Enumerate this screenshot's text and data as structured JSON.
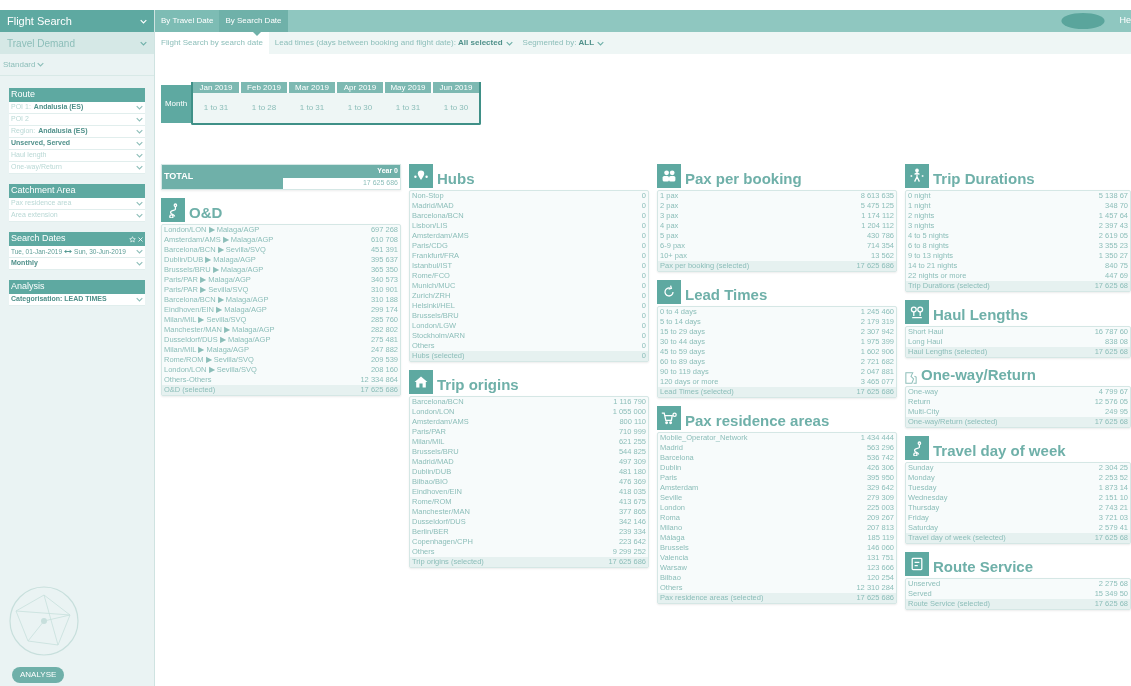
{
  "sidebar": {
    "title": "Flight Search",
    "module": "Travel Demand",
    "view": "Standard",
    "sections": [
      {
        "title": "Route",
        "kind": "plain",
        "fields": [
          {
            "kind": "select",
            "label": "POI 1:",
            "value": "Andalusia (ES)"
          },
          {
            "kind": "select",
            "label": "POI 2"
          },
          {
            "kind": "select",
            "label": "Region:",
            "value": "Andalusia (ES)"
          },
          {
            "kind": "select",
            "value": "Unserved, Served"
          },
          {
            "kind": "select",
            "label": "Haul length"
          },
          {
            "kind": "select",
            "label": "One-way/Return"
          }
        ]
      },
      {
        "title": "Catchment Area",
        "kind": "plain",
        "fields": [
          {
            "kind": "select",
            "label": "Pax residence area"
          },
          {
            "kind": "select",
            "label": "Area extension"
          }
        ]
      },
      {
        "title": "Search Dates",
        "kind": "dates",
        "fields": [
          {
            "kind": "range",
            "from": "Tue, 01-Jan-2019",
            "to": "Sun, 30-Jun-2019"
          },
          {
            "kind": "select",
            "value": "Monthly"
          }
        ]
      },
      {
        "title": "Analysis",
        "kind": "plain",
        "fields": [
          {
            "kind": "select",
            "value": "Categorisation: LEAD TIMES"
          }
        ]
      }
    ],
    "button": "ANALYSE"
  },
  "tabs": [
    {
      "label": "By Travel Date",
      "selected": false
    },
    {
      "label": "By Search Date",
      "selected": true
    }
  ],
  "user": "He",
  "subheader": {
    "title": "Flight Search by search date",
    "filters": [
      "Lead times (days between booking and flight date): **All selected**",
      "Segmented by: **ALL**"
    ]
  },
  "timeline": {
    "row_label": "Month",
    "months": [
      {
        "label": "Jan 2019",
        "range": "1 to 31"
      },
      {
        "label": "Feb 2019",
        "range": "1 to 28"
      },
      {
        "label": "Mar 2019",
        "range": "1 to 31"
      },
      {
        "label": "Apr 2019",
        "range": "1 to 30"
      },
      {
        "label": "May 2019",
        "range": "1 to 31"
      },
      {
        "label": "Jun 2019",
        "range": "1 to 30"
      }
    ]
  },
  "total": {
    "label": "TOTAL",
    "column": "Year 0",
    "value": "17 625 686"
  },
  "columns": [
    [
      {
        "title": "O&D",
        "kind": "route",
        "rows": [
          {
            "label": "London/LON ▶ Malaga/AGP",
            "value": "697 268"
          },
          {
            "label": "Amsterdam/AMS ▶ Malaga/AGP",
            "value": "610 708"
          },
          {
            "label": "Barcelona/BCN ▶ Sevilla/SVQ",
            "value": "451 391"
          },
          {
            "label": "Dublin/DUB ▶ Malaga/AGP",
            "value": "395 637"
          },
          {
            "label": "Brussels/BRU ▶ Malaga/AGP",
            "value": "365 350"
          },
          {
            "label": "Paris/PAR ▶ Malaga/AGP",
            "value": "340 573"
          },
          {
            "label": "Paris/PAR ▶ Sevilla/SVQ",
            "value": "310 901"
          },
          {
            "label": "Barcelona/BCN ▶ Malaga/AGP",
            "value": "310 188"
          },
          {
            "label": "Eindhoven/EIN ▶ Malaga/AGP",
            "value": "299 174"
          },
          {
            "label": "Milan/MIL ▶ Sevilla/SVQ",
            "value": "285 760"
          },
          {
            "label": "Manchester/MAN ▶ Malaga/AGP",
            "value": "282 802"
          },
          {
            "label": "Dusseldorf/DUS ▶ Malaga/AGP",
            "value": "275 481"
          },
          {
            "label": "Milan/MIL ▶ Malaga/AGP",
            "value": "247 882"
          },
          {
            "label": "Rome/ROM ▶ Sevilla/SVQ",
            "value": "209 539"
          },
          {
            "label": "London/LON ▶ Sevilla/SVQ",
            "value": "208 160"
          },
          {
            "label": "Others-Others",
            "value": "12 334 864"
          }
        ],
        "summary": {
          "label": "O&D (selected)",
          "value": "17 625 686"
        }
      }
    ],
    [
      {
        "title": "Hubs",
        "kind": "hubs",
        "rows": [
          {
            "label": "Non-Stop",
            "value": "0"
          },
          {
            "label": "Madrid/MAD",
            "value": "0"
          },
          {
            "label": "Barcelona/BCN",
            "value": "0"
          },
          {
            "label": "Lisbon/LIS",
            "value": "0"
          },
          {
            "label": "Amsterdam/AMS",
            "value": "0"
          },
          {
            "label": "Paris/CDG",
            "value": "0"
          },
          {
            "label": "Frankfurt/FRA",
            "value": "0"
          },
          {
            "label": "Istanbul/IST",
            "value": "0"
          },
          {
            "label": "Rome/FCO",
            "value": "0"
          },
          {
            "label": "Munich/MUC",
            "value": "0"
          },
          {
            "label": "Zurich/ZRH",
            "value": "0"
          },
          {
            "label": "Helsinki/HEL",
            "value": "0"
          },
          {
            "label": "Brussels/BRU",
            "value": "0"
          },
          {
            "label": "London/LGW",
            "value": "0"
          },
          {
            "label": "Stockholm/ARN",
            "value": "0"
          },
          {
            "label": "Others",
            "value": "0"
          }
        ],
        "summary": {
          "label": "Hubs (selected)",
          "value": "0"
        }
      },
      {
        "title": "Trip origins",
        "kind": "home",
        "rows": [
          {
            "label": "Barcelona/BCN",
            "value": "1 116 790"
          },
          {
            "label": "London/LON",
            "value": "1 055 000"
          },
          {
            "label": "Amsterdam/AMS",
            "value": "800 110"
          },
          {
            "label": "Paris/PAR",
            "value": "710 999"
          },
          {
            "label": "Milan/MIL",
            "value": "621 255"
          },
          {
            "label": "Brussels/BRU",
            "value": "544 825"
          },
          {
            "label": "Madrid/MAD",
            "value": "497 309"
          },
          {
            "label": "Dublin/DUB",
            "value": "481 180"
          },
          {
            "label": "Bilbao/BIO",
            "value": "476 369"
          },
          {
            "label": "Eindhoven/EIN",
            "value": "418 035"
          },
          {
            "label": "Rome/ROM",
            "value": "413 675"
          },
          {
            "label": "Manchester/MAN",
            "value": "377 865"
          },
          {
            "label": "Dusseldorf/DUS",
            "value": "342 146"
          },
          {
            "label": "Berlin/BER",
            "value": "239 334"
          },
          {
            "label": "Copenhagen/CPH",
            "value": "223 642"
          },
          {
            "label": "Others",
            "value": "9 299 252"
          }
        ],
        "summary": {
          "label": "Trip origins (selected)",
          "value": "17 625 686"
        }
      }
    ],
    [
      {
        "title": "Pax per booking",
        "kind": "people",
        "rows": [
          {
            "label": "1 pax",
            "value": "8 613 635"
          },
          {
            "label": "2 pax",
            "value": "5 475 125"
          },
          {
            "label": "3 pax",
            "value": "1 174 112"
          },
          {
            "label": "4 pax",
            "value": "1 204 112"
          },
          {
            "label": "5 pax",
            "value": "430 786"
          },
          {
            "label": "6-9 pax",
            "value": "714 354"
          },
          {
            "label": "10+ pax",
            "value": "13 562"
          }
        ],
        "summary": {
          "label": "Pax per booking (selected)",
          "value": "17 625 686"
        }
      },
      {
        "title": "Lead Times",
        "kind": "refresh",
        "rows": [
          {
            "label": "0 to 4 days",
            "value": "1 245 460"
          },
          {
            "label": "5 to 14 days",
            "value": "2 179 319"
          },
          {
            "label": "15 to 29 days",
            "value": "2 307 942"
          },
          {
            "label": "30 to 44 days",
            "value": "1 975 399"
          },
          {
            "label": "45 to 59 days",
            "value": "1 602 906"
          },
          {
            "label": "60 to 89 days",
            "value": "2 721 682"
          },
          {
            "label": "90 to 119 days",
            "value": "2 047 881"
          },
          {
            "label": "120 days or more",
            "value": "3 465 077"
          }
        ],
        "summary": {
          "label": "Lead Times (selected)",
          "value": "17 625 686"
        }
      },
      {
        "title": "Pax residence areas",
        "kind": "cart",
        "rows": [
          {
            "label": "Mobile_Operator_Network",
            "value": "1 434 444"
          },
          {
            "label": "Madrid",
            "value": "563 296"
          },
          {
            "label": "Barcelona",
            "value": "536 742"
          },
          {
            "label": "Dublin",
            "value": "426 306"
          },
          {
            "label": "Paris",
            "value": "395 950"
          },
          {
            "label": "Amsterdam",
            "value": "329 642"
          },
          {
            "label": "Seville",
            "value": "279 309"
          },
          {
            "label": "London",
            "value": "225 003"
          },
          {
            "label": "Roma",
            "value": "209 267"
          },
          {
            "label": "Milano",
            "value": "207 813"
          },
          {
            "label": "Málaga",
            "value": "185 119"
          },
          {
            "label": "Brussels",
            "value": "146 060"
          },
          {
            "label": "Valencia",
            "value": "131 751"
          },
          {
            "label": "Warsaw",
            "value": "123 666"
          },
          {
            "label": "Bilbao",
            "value": "120 254"
          },
          {
            "label": "Others",
            "value": "12 310 284"
          }
        ],
        "summary": {
          "label": "Pax residence areas (selected)",
          "value": "17 625 686"
        }
      }
    ],
    [
      {
        "title": "Trip Durations",
        "kind": "walker",
        "rows": [
          {
            "label": "0 night",
            "value": "5 138 67"
          },
          {
            "label": "1 night",
            "value": "348 70"
          },
          {
            "label": "2 nights",
            "value": "1 457 64"
          },
          {
            "label": "3 nights",
            "value": "2 397 43"
          },
          {
            "label": "4 to 5 nights",
            "value": "2 619 05"
          },
          {
            "label": "6 to 8 nights",
            "value": "3 355 23"
          },
          {
            "label": "9 to 13 nights",
            "value": "1 350 27"
          },
          {
            "label": "14 to 21 nights",
            "value": "840 75"
          },
          {
            "label": "22 nights or more",
            "value": "447 69"
          }
        ],
        "summary": {
          "label": "Trip Durations (selected)",
          "value": "17 625 68"
        }
      },
      {
        "title": "Haul Lengths",
        "kind": "haul",
        "rows": [
          {
            "label": "Short Haul",
            "value": "16 787 60"
          },
          {
            "label": "Long Haul",
            "value": "838 08"
          }
        ],
        "summary": {
          "label": "Haul Lengths (selected)",
          "value": "17 625 68"
        }
      },
      {
        "title": "One-way/Return",
        "kind": "broken",
        "rows": [
          {
            "label": "One-way",
            "value": "4 799 67"
          },
          {
            "label": "Return",
            "value": "12 576 05"
          },
          {
            "label": "Multi-City",
            "value": "249 95"
          }
        ],
        "summary": {
          "label": "One-way/Return (selected)",
          "value": "17 625 68"
        }
      },
      {
        "title": "Travel day of week",
        "kind": "route",
        "rows": [
          {
            "label": "Sunday",
            "value": "2 304 25"
          },
          {
            "label": "Monday",
            "value": "2 253 52"
          },
          {
            "label": "Tuesday",
            "value": "1 873 14"
          },
          {
            "label": "Wednesday",
            "value": "2 151 10"
          },
          {
            "label": "Thursday",
            "value": "2 743 21"
          },
          {
            "label": "Friday",
            "value": "3 721 03"
          },
          {
            "label": "Saturday",
            "value": "2 579 41"
          }
        ],
        "summary": {
          "label": "Travel day of week (selected)",
          "value": "17 625 68"
        }
      },
      {
        "title": "Route Service",
        "kind": "service",
        "rows": [
          {
            "label": "Unserved",
            "value": "2 275 68"
          },
          {
            "label": "Served",
            "value": "15 349 50"
          }
        ],
        "summary": {
          "label": "Route Service (selected)",
          "value": "17 625 68"
        }
      }
    ]
  ]
}
